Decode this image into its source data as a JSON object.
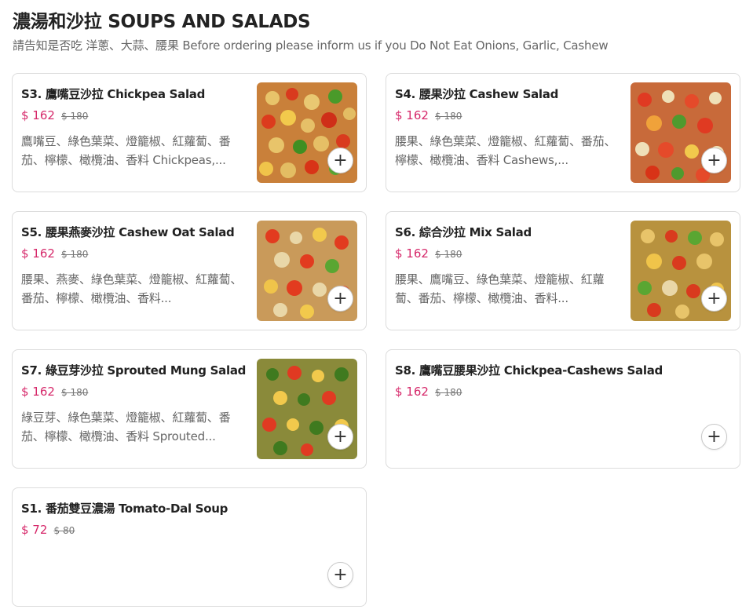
{
  "section": {
    "title": "濃湯和沙拉 SOUPS AND SALADS",
    "note": "請告知是否吃 洋蔥、大蒜、腰果 Before ordering please inform us if you Do Not Eat Onions, Garlic, Cashew"
  },
  "items": [
    {
      "name": "S3. 鷹嘴豆沙拉 Chickpea Salad",
      "price": "$ 162",
      "original_price": "$ 180",
      "description": "鷹嘴豆、綠色葉菜、燈籠椒、紅蘿蔔、番茄、檸檬、橄欖油、香料 Chickpeas,...",
      "add_label": "+"
    },
    {
      "name": "S4. 腰果沙拉 Cashew Salad",
      "price": "$ 162",
      "original_price": "$ 180",
      "description": "腰果、綠色葉菜、燈籠椒、紅蘿蔔、番茄、檸檬、橄欖油、香料 Cashews,...",
      "add_label": "+"
    },
    {
      "name": "S5. 腰果燕麥沙拉 Cashew Oat Salad",
      "price": "$ 162",
      "original_price": "$ 180",
      "description": "腰果、燕麥、綠色葉菜、燈籠椒、紅蘿蔔、番茄、檸檬、橄欖油、香料...",
      "add_label": "+"
    },
    {
      "name": "S6. 綜合沙拉 Mix Salad",
      "price": "$ 162",
      "original_price": "$ 180",
      "description": "腰果、鷹嘴豆、綠色葉菜、燈籠椒、紅蘿蔔、番茄、檸檬、橄欖油、香料...",
      "add_label": "+"
    },
    {
      "name": "S7. 綠豆芽沙拉 Sprouted Mung Salad",
      "price": "$ 162",
      "original_price": "$ 180",
      "description": "綠豆芽、綠色葉菜、燈籠椒、紅蘿蔔、番茄、檸檬、橄欖油、香料 Sprouted...",
      "add_label": "+"
    },
    {
      "name": "S8. 鷹嘴豆腰果沙拉 Chickpea-Cashews Salad",
      "price": "$ 162",
      "original_price": "$ 180",
      "description": "",
      "add_label": "+"
    },
    {
      "name": "S1. 番茄雙豆濃湯 Tomato-Dal Soup",
      "price": "$ 72",
      "original_price": "$ 80",
      "description": "",
      "add_label": "+"
    }
  ],
  "colors": {
    "price": "#d6286a",
    "border": "#dcdcdc"
  }
}
